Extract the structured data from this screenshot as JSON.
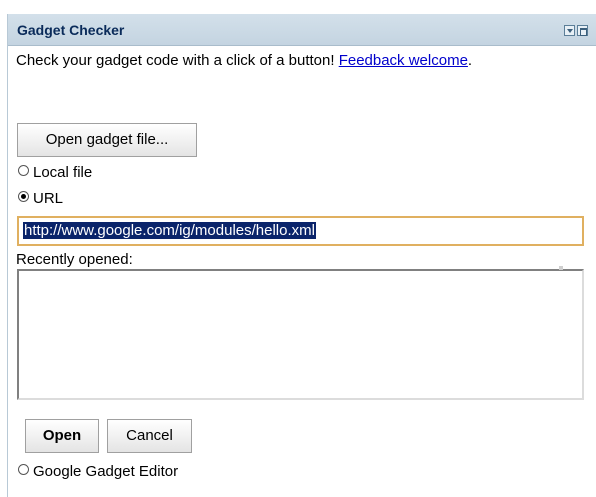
{
  "gadget": {
    "title": "Gadget Checker",
    "menu_icon": "dropdown-menu-icon",
    "minimize_icon": "minimize-icon"
  },
  "description": {
    "text": "Check your gadget code with a click of a button! ",
    "feedback_link": "Feedback welcome",
    "suffix": "."
  },
  "buttons": {
    "open_file": "Open gadget file...",
    "open": "Open",
    "cancel": "Cancel"
  },
  "sources": {
    "local_file": "Local file",
    "url": "URL",
    "selected": "URL",
    "gadget_editor": "Google Gadget Editor"
  },
  "url_field": {
    "value": "http://www.google.com/ig/modules/hello.xml"
  },
  "recent": {
    "label": "Recently opened:",
    "items": []
  },
  "colors": {
    "title_text": "#0a2b5a",
    "link": "#0000cc",
    "selection_bg": "#0a246a",
    "input_focus_border": "#e0b060"
  }
}
